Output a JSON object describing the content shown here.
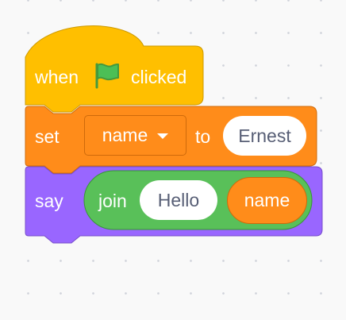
{
  "blocks": {
    "hat": {
      "when": "when",
      "flag_icon": "green-flag-icon",
      "clicked": "clicked",
      "color": "#ffbf00"
    },
    "set": {
      "label": "set",
      "variable": "name",
      "to": "to",
      "value": "Ernest",
      "color": "#ff8c1a"
    },
    "say": {
      "label": "say",
      "color": "#9966ff",
      "join": {
        "label": "join",
        "first": "Hello",
        "second_variable": "name",
        "color": "#59c059"
      }
    }
  }
}
